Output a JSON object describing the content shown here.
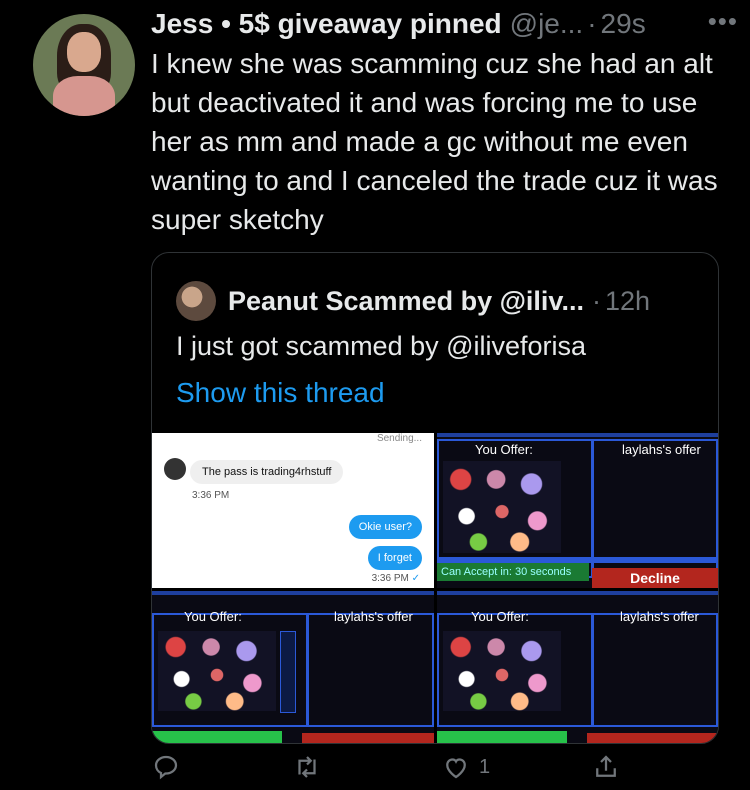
{
  "tweet": {
    "author_name": "Jess • 5$ giveaway pinned",
    "handle": "@je...",
    "time": "29s",
    "more": "•••",
    "text": "I knew she was scamming cuz she had an alt but deactivated it and was forcing me to use her as mm and made a gc without me even wanting to and I canceled the trade cuz it was super sketchy"
  },
  "quoted": {
    "author_name": "Peanut Scammed by @iliv...",
    "time": "12h",
    "text": "I just got scammed by @iliveforisa",
    "link": "Show this thread",
    "dm": {
      "sending": "Sending...",
      "incoming": "The pass is trading4rhstuff",
      "incoming_time": "3:36 PM",
      "outgoing_1": "Okie user?",
      "outgoing_2": "I forget",
      "outgoing_time": "3:36 PM"
    },
    "trade": {
      "you_offer": "You Offer:",
      "their_offer": "laylahs's offer",
      "accept_timer": "Can Accept in: 30 seconds",
      "decline": "Decline"
    }
  },
  "actions": {
    "like_count": "1"
  },
  "colors": {
    "background": "#000000",
    "text": "#e7e9ea",
    "muted": "#71767b",
    "link": "#1d9bf0"
  }
}
